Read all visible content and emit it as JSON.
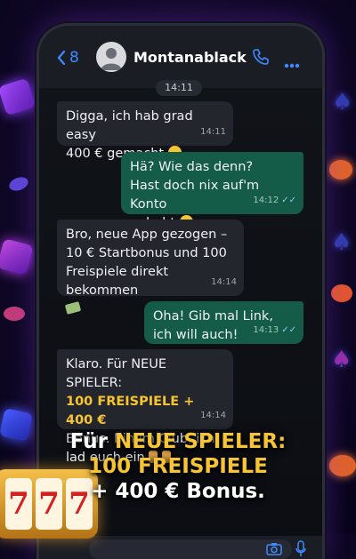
{
  "header": {
    "back_count": "8",
    "contact_name": "Montanablack"
  },
  "chat": {
    "date": "14:11",
    "messages": [
      {
        "dir": "in",
        "lines": [
          "Digga, ich hab grad easy",
          "400 € gemacht"
        ],
        "time": "14:11",
        "emoji": "grinning-sweat-emoji"
      },
      {
        "dir": "out",
        "lines": [
          "Hä? Wie das denn?",
          "Hast doch nix auf'm Konto",
          "gehabt"
        ],
        "time": "14:12",
        "read": true,
        "emoji": "grinning-sweat-emoji"
      },
      {
        "dir": "in",
        "lines": [
          "Bro, neue App gezogen –",
          "10 € Startbonus und 100",
          "Freispiele direkt bekommen"
        ],
        "time": "14:14",
        "emoji": "money-wings-emoji"
      },
      {
        "dir": "out",
        "lines": [
          "Oha! Gib mal Link,",
          "ich will auch!"
        ],
        "time": "14:13",
        "read": true
      },
      {
        "dir": "in",
        "lines": [
          "Klaro. Für NEUE SPIELER:",
          "100 FREISPIELE + 400 €",
          "Bonus. Bin im Club, ich",
          "lad euch ein"
        ],
        "time": "14:14",
        "emoji": "point-down-emoji"
      }
    ]
  },
  "promo": {
    "line1_prefix": "Für ",
    "line1_gold": "NEUE SPIELER:",
    "line2": "100 FREISPIELE",
    "line3": "+ 400 € Bonus."
  },
  "colors": {
    "accent_blue": "#3d8bff",
    "incoming_bubble": "#24262e",
    "outgoing_bubble": "#145c47",
    "promo_gold": "#f7c434",
    "highlight_gold": "#f7c52e"
  },
  "icons": [
    "chevron-left-icon",
    "avatar-icon",
    "phone-icon",
    "more-icon",
    "camera-icon",
    "microphone-icon"
  ]
}
